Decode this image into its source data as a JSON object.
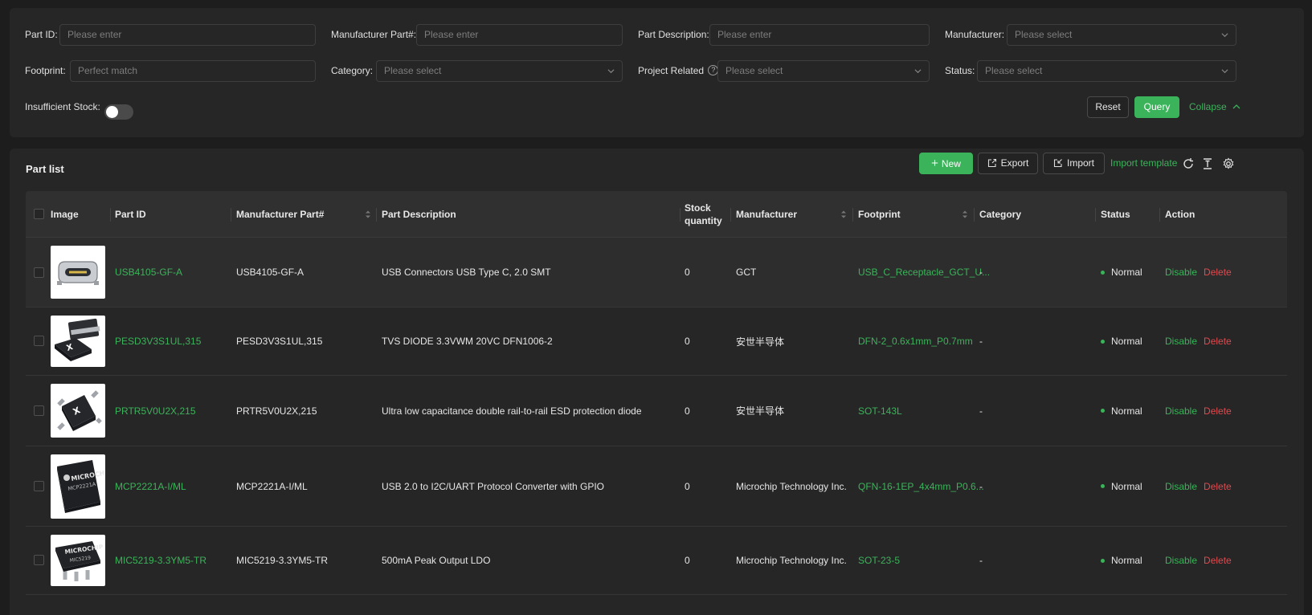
{
  "filters": {
    "part_id": {
      "label": "Part ID",
      "placeholder": "Please enter"
    },
    "manufacturer_part": {
      "label": "Manufacturer Part#",
      "placeholder": "Please enter"
    },
    "part_description": {
      "label": "Part Description",
      "placeholder": "Please enter"
    },
    "manufacturer": {
      "label": "Manufacturer",
      "placeholder": "Please select"
    },
    "footprint": {
      "label": "Footprint",
      "placeholder": "Perfect match"
    },
    "category": {
      "label": "Category",
      "placeholder": "Please select"
    },
    "project_related": {
      "label": "Project Related",
      "placeholder": "Please select"
    },
    "status": {
      "label": "Status",
      "placeholder": "Please select"
    },
    "insufficient_stock": {
      "label": "Insufficient Stock",
      "enabled": false
    },
    "reset_label": "Reset",
    "query_label": "Query",
    "collapse_label": "Collapse"
  },
  "list": {
    "title": "Part list",
    "new_label": "New",
    "export_label": "Export",
    "import_label": "Import",
    "import_template_label": "Import template",
    "columns": {
      "image": "Image",
      "part_id": "Part ID",
      "manufacturer_part": "Manufacturer Part#",
      "description": "Part Description",
      "stock_line1": "Stock",
      "stock_line2": "quantity",
      "manufacturer": "Manufacturer",
      "footprint": "Footprint",
      "category": "Category",
      "status": "Status",
      "action": "Action"
    },
    "rows": [
      {
        "part_id": "USB4105-GF-A",
        "mpn": "USB4105-GF-A",
        "description": "USB Connectors USB Type C, 2.0 SMT",
        "stock": "0",
        "manufacturer": "GCT",
        "footprint": "USB_C_Receptacle_GCT_U...",
        "category": "-",
        "status": "Normal",
        "disable": "Disable",
        "delete": "Delete",
        "image_icon": "usb-c-connector-image"
      },
      {
        "part_id": "PESD3V3S1UL,315",
        "mpn": "PESD3V3S1UL,315",
        "description": "TVS DIODE 3.3VWM 20VC DFN1006-2",
        "stock": "0",
        "manufacturer": "安世半导体",
        "footprint": "DFN-2_0.6x1mm_P0.7mm",
        "category": "-",
        "status": "Normal",
        "disable": "Disable",
        "delete": "Delete",
        "image_icon": "dfn-package-image"
      },
      {
        "part_id": "PRTR5V0U2X,215",
        "mpn": "PRTR5V0U2X,215",
        "description": "Ultra low capacitance double rail-to-rail ESD protection diode",
        "stock": "0",
        "manufacturer": "安世半导体",
        "footprint": "SOT-143L",
        "category": "-",
        "status": "Normal",
        "disable": "Disable",
        "delete": "Delete",
        "image_icon": "sot143-package-image"
      },
      {
        "part_id": "MCP2221A-I/ML",
        "mpn": "MCP2221A-I/ML",
        "description": "USB 2.0 to I2C/UART Protocol Converter with GPIO",
        "stock": "0",
        "manufacturer": "Microchip Technology Inc.",
        "footprint": "QFN-16-1EP_4x4mm_P0.6...",
        "category": "-",
        "status": "Normal",
        "disable": "Disable",
        "delete": "Delete",
        "image_icon": "qfn-chip-image",
        "chip_marking": "MCP2221A"
      },
      {
        "part_id": "MIC5219-3.3YM5-TR",
        "mpn": "MIC5219-3.3YM5-TR",
        "description": "500mA Peak Output LDO",
        "stock": "0",
        "manufacturer": "Microchip Technology Inc.",
        "footprint": "SOT-23-5",
        "category": "-",
        "status": "Normal",
        "disable": "Disable",
        "delete": "Delete",
        "image_icon": "sot23-chip-image",
        "chip_marking": "MIC5219"
      }
    ]
  },
  "colors": {
    "accent": "#3bb35a",
    "danger": "#e5484d",
    "background": "#1d1d1d",
    "panel": "#262626"
  }
}
